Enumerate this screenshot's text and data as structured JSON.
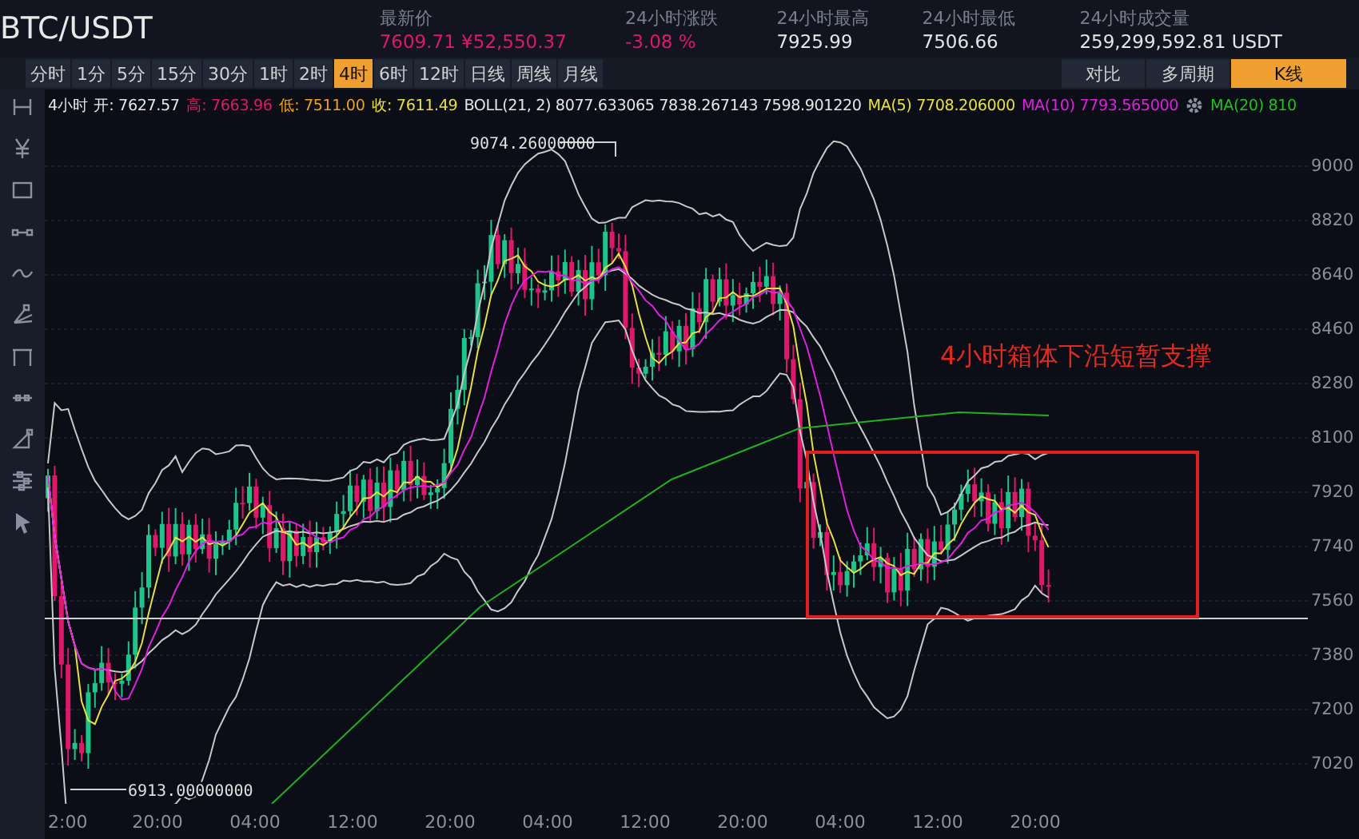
{
  "header": {
    "pair": "BTC/USDT",
    "stats": [
      {
        "label": "最新价",
        "value": "7609.71 ¥52,550.37",
        "color": "#e0186c"
      },
      {
        "label": "24小时涨跌",
        "value": "-3.08 %",
        "color": "#e0186c"
      },
      {
        "label": "24小时最高",
        "value": "7925.99",
        "color": "#e6e6e6"
      },
      {
        "label": "24小时最低",
        "value": "7506.66",
        "color": "#e6e6e6"
      },
      {
        "label": "24小时成交量",
        "value": "259,299,592.81 USDT",
        "color": "#e6e6e6"
      }
    ]
  },
  "toolbar": {
    "intervals": [
      {
        "label": "分时",
        "selected": false
      },
      {
        "label": "1分",
        "selected": false
      },
      {
        "label": "5分",
        "selected": false
      },
      {
        "label": "15分",
        "selected": false
      },
      {
        "label": "30分",
        "selected": false
      },
      {
        "label": "1时",
        "selected": false
      },
      {
        "label": "2时",
        "selected": false
      },
      {
        "label": "4时",
        "selected": true
      },
      {
        "label": "6时",
        "selected": false
      },
      {
        "label": "12时",
        "selected": false
      },
      {
        "label": "日线",
        "selected": false
      },
      {
        "label": "周线",
        "selected": false
      },
      {
        "label": "月线",
        "selected": false
      }
    ],
    "views": [
      {
        "label": "对比",
        "selected": false
      },
      {
        "label": "多周期",
        "selected": false
      },
      {
        "label": "K线",
        "selected": true
      }
    ]
  },
  "indicators": [
    {
      "text": "4小时 开: 7627.57",
      "color": "#e6e6e6"
    },
    {
      "text": "高: 7663.96",
      "color": "#e0186c"
    },
    {
      "text": "低: 7511.00",
      "color": "#f0a020"
    },
    {
      "text": "收: 7611.49",
      "color": "#e8e040"
    },
    {
      "text": "BOLL(21, 2) 8077.633065 7838.267143 7598.901220",
      "color": "#e6e6e6"
    },
    {
      "text": "MA(5) 7708.206000",
      "color": "#e8e040"
    },
    {
      "text": "MA(10) 7793.565000",
      "color": "#e020e0"
    },
    {
      "text": "MA(20) 810",
      "color": "#20c020"
    }
  ],
  "price_axis": [
    "9000",
    "8820",
    "8640",
    "8460",
    "8280",
    "8100",
    "7920",
    "7740",
    "7560",
    "7380",
    "7200",
    "7020"
  ],
  "time_axis": [
    "2:00",
    "20:00",
    "04:00",
    "12:00",
    "20:00",
    "04:00",
    "12:00",
    "20:00",
    "04:00",
    "12:00",
    "20:00"
  ],
  "annotations": {
    "high_label": "9074.26000000",
    "low_label": "6913.00000000",
    "note": "4小时箱体下沿短暂支撑"
  }
}
